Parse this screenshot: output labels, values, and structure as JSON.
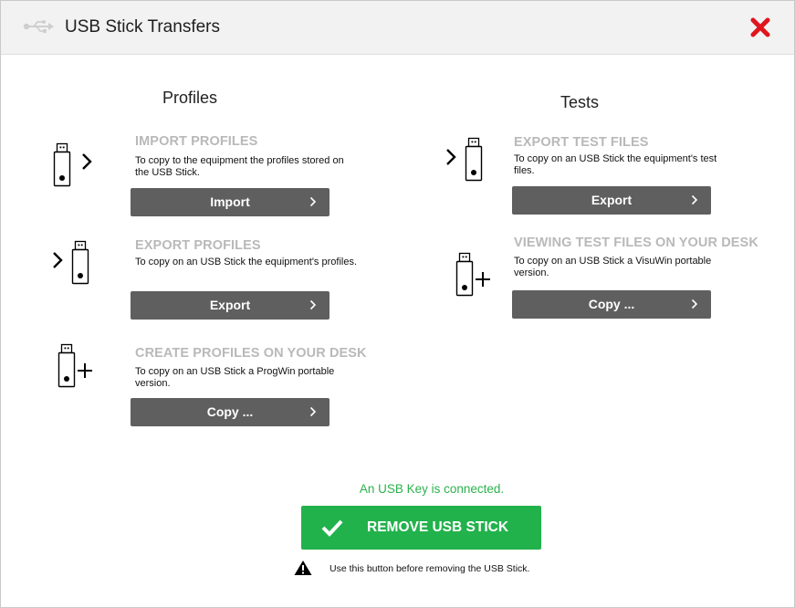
{
  "window": {
    "title": "USB Stick Transfers",
    "close_icon": "close-x-icon",
    "title_icon": "usb-symbol-icon"
  },
  "colors": {
    "accent_green": "#22b24c",
    "status_green": "#2bb24c",
    "button_gray": "#5f5f5f",
    "section_title_gray": "#b9b9b9",
    "close_red": "#e0161f"
  },
  "profiles": {
    "heading": "Profiles",
    "import": {
      "title": "IMPORT PROFILES",
      "desc_line1": "To copy to the equipment the profiles stored on",
      "desc_line2": "the USB Stick.",
      "button": "Import",
      "icon": "usb-import-icon"
    },
    "export": {
      "title": "EXPORT PROFILES",
      "desc_line1": "To copy on an USB Stick the equipment's profiles.",
      "button": "Export",
      "icon": "usb-export-icon"
    },
    "create": {
      "title": "CREATE PROFILES ON YOUR DESK",
      "desc_line1": "To copy on an USB Stick a ProgWin portable",
      "desc_line2": "version.",
      "button": "Copy ...",
      "icon": "usb-add-icon"
    }
  },
  "tests": {
    "heading": "Tests",
    "export": {
      "title": "EXPORT TEST FILES",
      "desc_line1": "To copy on an USB Stick the equipment's test",
      "desc_line2": "files.",
      "button": "Export",
      "icon": "usb-export-icon"
    },
    "view": {
      "title": "VIEWING TEST FILES ON YOUR DESK",
      "desc_line1": "To copy on an USB Stick a VisuWin portable",
      "desc_line2": "version.",
      "button": "Copy ...",
      "icon": "usb-add-icon"
    }
  },
  "footer": {
    "status": "An USB Key is connected.",
    "remove_button": "REMOVE USB STICK",
    "warning": "Use this button before removing the USB Stick."
  }
}
